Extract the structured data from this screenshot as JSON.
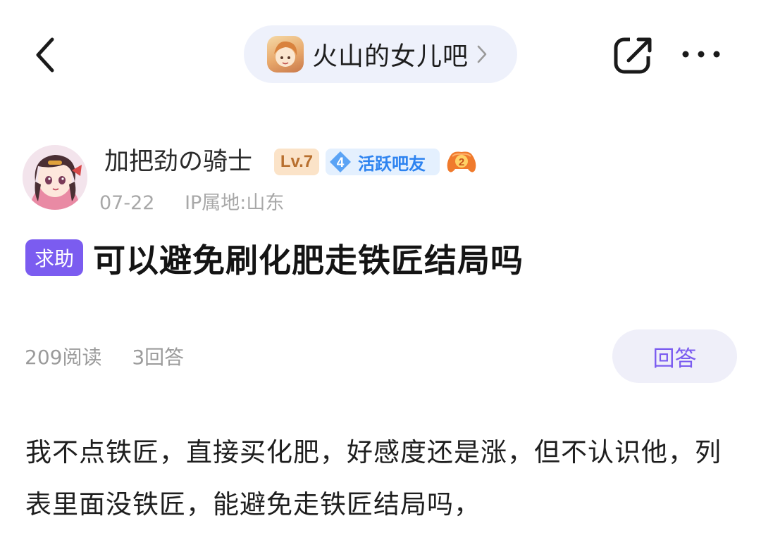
{
  "header": {
    "forum_name": "火山的女儿吧",
    "back_icon": "chevron-left-icon",
    "share_icon": "share-icon",
    "more_icon": "more-icon"
  },
  "author": {
    "name": "加把劲の骑士",
    "level": "Lv.7",
    "active_level": "4",
    "active_label": "活跃吧友",
    "date": "07-22",
    "ip_location": "IP属地:山东"
  },
  "post": {
    "tag": "求助",
    "title": "可以避免刷化肥走铁匠结局吗",
    "views": "209阅读",
    "answers": "3回答",
    "reply_label": "回答",
    "body": "我不点铁匠，直接买化肥，好感度还是涨，但不认识他，列表里面没铁匠，能避免走铁匠结局吗，"
  },
  "colors": {
    "accent": "#7b5cf0",
    "pill_bg": "#eef1fb",
    "active_blue": "#2d83f0",
    "level_orange": "#b8702f"
  }
}
